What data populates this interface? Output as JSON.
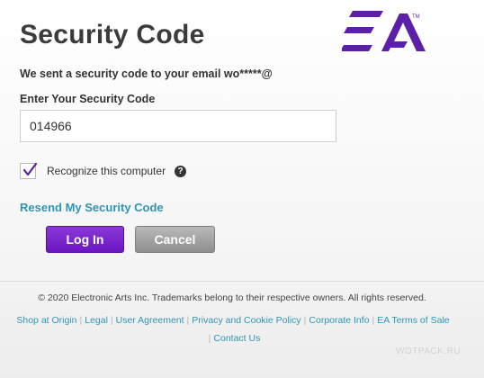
{
  "page": {
    "title": "Security Code",
    "subtitle": "We sent a security code to your email wo*****@"
  },
  "logo": {
    "text": "EA",
    "trademark": "TM",
    "color": "#5c1fa8"
  },
  "form": {
    "code_label": "Enter Your Security Code",
    "code_value": "014966",
    "remember_label": "Recognize this computer",
    "remember_checked": true,
    "help_icon": "?",
    "resend_link": "Resend My Security Code",
    "login_button": "Log In",
    "cancel_button": "Cancel"
  },
  "footer": {
    "copyright": "© 2020 Electronic Arts Inc. Trademarks belong to their respective owners. All rights reserved.",
    "links": [
      "Shop at Origin",
      "Legal",
      "User Agreement",
      "Privacy and Cookie Policy",
      "Corporate Info",
      "EA Terms of Sale",
      "Contact Us"
    ]
  },
  "watermark": "WOTPACK.RU",
  "colors": {
    "accent_purple": "#6b16c2",
    "link_blue": "#2f95b4",
    "title_gray": "#3b3b3b"
  }
}
